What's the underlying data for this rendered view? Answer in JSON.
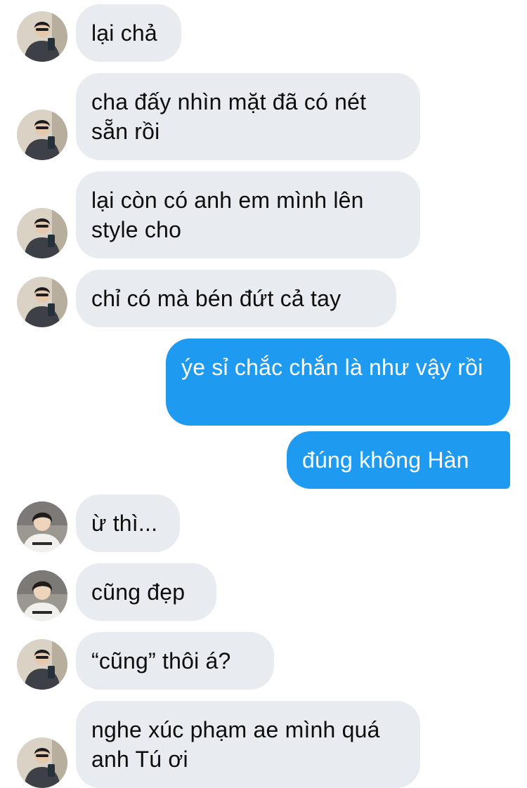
{
  "messages": [
    {
      "side": "in",
      "sender": "A",
      "text": "lại chả"
    },
    {
      "side": "in",
      "sender": "A",
      "text": "cha đấy nhìn mặt đã có nét sẵn rồi"
    },
    {
      "side": "in",
      "sender": "A",
      "text": "lại còn có anh em mình lên style cho"
    },
    {
      "side": "in",
      "sender": "A",
      "text": "chỉ có mà bén đứt cả tay"
    },
    {
      "side": "out",
      "text": "ýe sỉ chắc chắn là như vậy rồi"
    },
    {
      "side": "out",
      "text": "đúng không Hàn"
    },
    {
      "side": "in",
      "sender": "B",
      "text": "ừ thì..."
    },
    {
      "side": "in",
      "sender": "B",
      "text": "cũng đẹp"
    },
    {
      "side": "in",
      "sender": "A",
      "text": "“cũng” thôi á?"
    },
    {
      "side": "in",
      "sender": "A",
      "text": "nghe xúc phạm ae mình quá anh Tú ơi"
    }
  ],
  "avatars": {
    "A": {
      "icon": "avatar-dark-hoodie-mirror-selfie-icon"
    },
    "B": {
      "icon": "avatar-white-tee-boy-icon"
    }
  },
  "colors": {
    "incoming_bubble": "#e8ecf0",
    "outgoing_bubble": "#1e9bf0",
    "incoming_text": "#0d0d0d",
    "outgoing_text": "#ffffff"
  }
}
